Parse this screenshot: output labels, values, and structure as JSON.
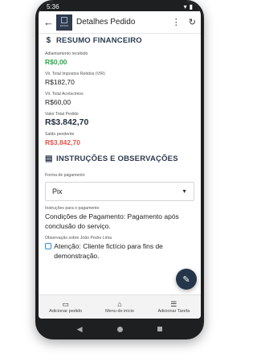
{
  "status_bar": {
    "time": "5:36",
    "wifi_icon": "wifi-icon",
    "battery_icon": "battery-icon"
  },
  "app_bar": {
    "title": "Detalhes Pedido",
    "logo_text": "EDSIM"
  },
  "financial": {
    "title": "RESUMO FINANCEIRO",
    "fields": [
      {
        "label": "Adiantamento recebido",
        "value": "R$0,00",
        "style": "green"
      },
      {
        "label": "Vlr. Total Impostos Retidos (VIR)",
        "value": "R$182,70",
        "style": "normal"
      },
      {
        "label": "Vlr. Total Acréscimos",
        "value": "R$60,00",
        "style": "normal"
      },
      {
        "label": "Valor Total Pedido",
        "value": "R$3.842,70",
        "style": "big"
      },
      {
        "label": "Saldo pendente",
        "value": "R$3.842,70",
        "style": "red"
      }
    ]
  },
  "instructions": {
    "title": "INSTRUÇÕES E OBSERVAÇÕES",
    "payment_label": "Forma de pagamento",
    "payment_value": "Pix",
    "instructions_label": "Instruções para o pagamento",
    "instructions_value": "Condições de Pagamento: Pagamento após conclusão do serviço.",
    "observation_label": "Observação sobre João Pedro Lima",
    "observation_value": "Atenção: Cliente fictício para fins de demonstração."
  },
  "bottom_nav": [
    {
      "label": "Adicionar pedido",
      "icon": "folder-add-icon"
    },
    {
      "label": "Menu de início",
      "icon": "home-icon"
    },
    {
      "label": "Adicionar Tarefa",
      "icon": "checklist-icon"
    }
  ],
  "colors": {
    "accent": "#25364a",
    "green": "#2ba64b",
    "red": "#e0574b"
  }
}
